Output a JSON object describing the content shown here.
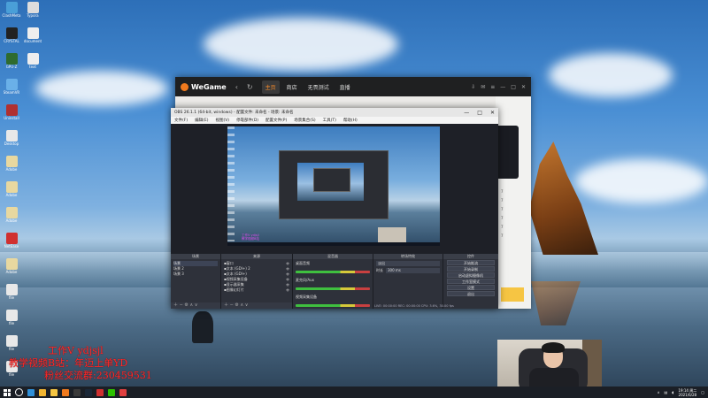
{
  "desktop": {
    "icons_col1": [
      {
        "label": "ClashMeta",
        "color": "#4a9fd8"
      },
      {
        "label": "CRYSTAL",
        "color": "#222"
      },
      {
        "label": "GPU-Z",
        "color": "#2e6b2e"
      },
      {
        "label": "SteamVR",
        "color": "#6ab0e8"
      },
      {
        "label": "Uninstall",
        "color": "#b03030"
      },
      {
        "label": "Desktop",
        "color": "#e8e8e8"
      },
      {
        "label": "Adobe",
        "color": "#e8d8a0"
      },
      {
        "label": "Adobe",
        "color": "#e8d8a0"
      },
      {
        "label": "Adobe",
        "color": "#e8d8a0"
      },
      {
        "label": "NetEase",
        "color": "#d03030"
      },
      {
        "label": "Adobe",
        "color": "#e8d8a0"
      },
      {
        "label": "file",
        "color": "#e8e8e8"
      },
      {
        "label": "file",
        "color": "#e8e8e8"
      },
      {
        "label": "file",
        "color": "#e8e8e8"
      },
      {
        "label": "file",
        "color": "#e8e8e8"
      }
    ],
    "icons_col2": [
      {
        "label": "Typora",
        "color": "#ddd"
      },
      {
        "label": "document",
        "color": "#eee"
      },
      {
        "label": "text",
        "color": "#eee"
      }
    ]
  },
  "wegame": {
    "brand": "WeGame",
    "tabs": [
      {
        "label": "主页",
        "active": true
      },
      {
        "label": "商店",
        "active": false
      },
      {
        "label": "无畏测试",
        "active": false
      },
      {
        "label": "直播",
        "active": false
      }
    ],
    "list_items": [
      "7",
      "7",
      "7",
      "7",
      "7",
      "7"
    ]
  },
  "obs": {
    "title": "OBS 26.1.1 (64-bit, windows) - 配置文件: 未命名 - 场景: 未命名",
    "window_controls": [
      "—",
      "□",
      "✕"
    ],
    "menu": [
      "文件(F)",
      "编辑(E)",
      "视图(V)",
      "停靠部件(D)",
      "配置文件(P)",
      "场景集合(S)",
      "工具(T)",
      "帮助(H)"
    ],
    "panels": {
      "scenes": {
        "header": "场景",
        "items": [
          "场景",
          "场景 2",
          "场景 3"
        ]
      },
      "sources": {
        "header": "来源",
        "items": [
          "窗口",
          "文本 (GDI+) 2",
          "文本 (GDI+)",
          "视频采集设备",
          "显示器采集",
          "图像幻灯片"
        ]
      },
      "mixer": {
        "header": "混音器",
        "channels": [
          "桌面音频",
          "麦克风/Aux",
          "视频采集设备"
        ]
      },
      "transitions": {
        "header": "转场特效",
        "type": "淡出",
        "duration_label": "时长",
        "duration": "300 ms"
      },
      "controls": {
        "header": "控件",
        "buttons": [
          "开始推流",
          "开始录制",
          "启动虚拟摄像机",
          "工作室模式",
          "设置",
          "退出"
        ]
      }
    },
    "canvas_caption": [
      "工作V ydjsjl",
      "教学视频B站"
    ],
    "status": "LIVE: 00:00:00   REC: 00:00:00   CPU: 3.6%, 30.00 fps"
  },
  "overlay": {
    "line1": "工作V ydjsjl",
    "line2": "教学视频B站：年迈上单YD",
    "line3": "粉丝交流群:230459531"
  },
  "taskbar": {
    "apps": [
      {
        "name": "edge",
        "color": "#2f8fd8"
      },
      {
        "name": "chrome",
        "color": "#f2b632"
      },
      {
        "name": "explorer",
        "color": "#f5c542"
      },
      {
        "name": "wegame",
        "color": "#f07a1e"
      },
      {
        "name": "obs",
        "color": "#3a3a3a"
      },
      {
        "name": "steam",
        "color": "#1b2838"
      },
      {
        "name": "netease",
        "color": "#d03030"
      },
      {
        "name": "wechat",
        "color": "#2dc100"
      },
      {
        "name": "app",
        "color": "#e04040"
      }
    ],
    "clock_time": "19:14 周二",
    "clock_date": "2021/6/28"
  }
}
